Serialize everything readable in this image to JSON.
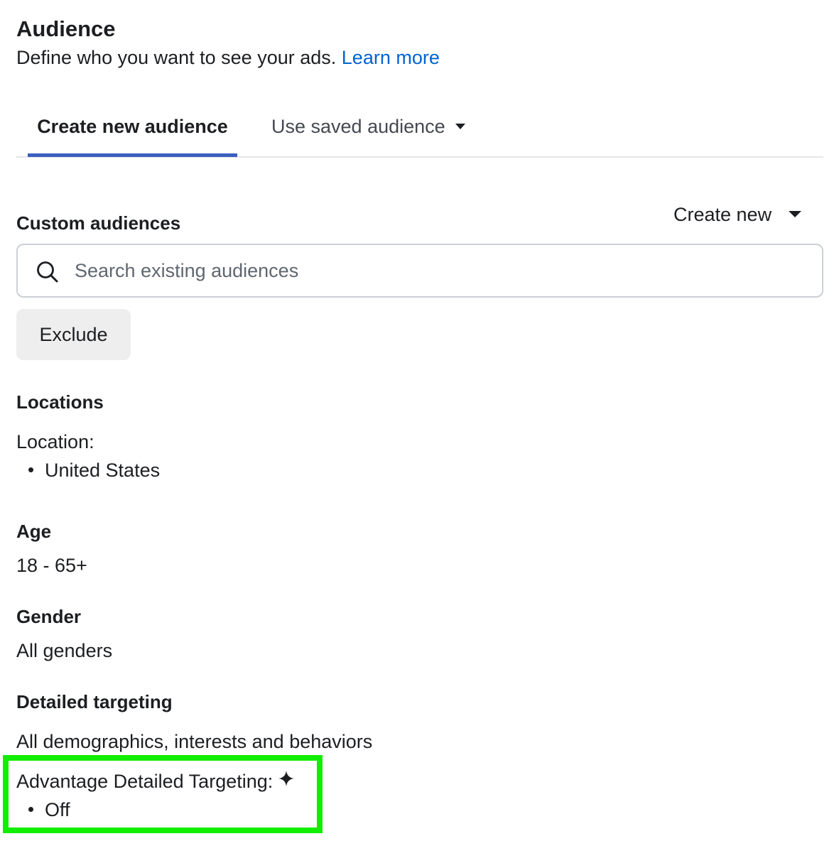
{
  "header": {
    "title": "Audience",
    "subtitle": "Define who you want to see your ads.",
    "learn_more": "Learn more"
  },
  "tabs": [
    {
      "label": "Create new audience",
      "active": true
    },
    {
      "label": "Use saved audience",
      "active": false
    }
  ],
  "custom_audiences": {
    "label": "Custom audiences",
    "create_new_label": "Create new",
    "search_placeholder": "Search existing audiences",
    "exclude_label": "Exclude"
  },
  "locations": {
    "label": "Locations",
    "location_label": "Location:",
    "items": [
      "United States"
    ]
  },
  "age": {
    "label": "Age",
    "value": "18 - 65+"
  },
  "gender": {
    "label": "Gender",
    "value": "All genders"
  },
  "detailed_targeting": {
    "label": "Detailed targeting",
    "value": "All demographics, interests and behaviors",
    "advantage_label": "Advantage Detailed Targeting:",
    "advantage_value": "Off"
  },
  "icons": {
    "search": "search-icon",
    "dropdown": "caret-down-icon",
    "advantage": "sparkle-icon"
  },
  "colors": {
    "link": "#0064d1",
    "tab_underline": "#3b5fbf",
    "highlight": "#12ee00"
  }
}
